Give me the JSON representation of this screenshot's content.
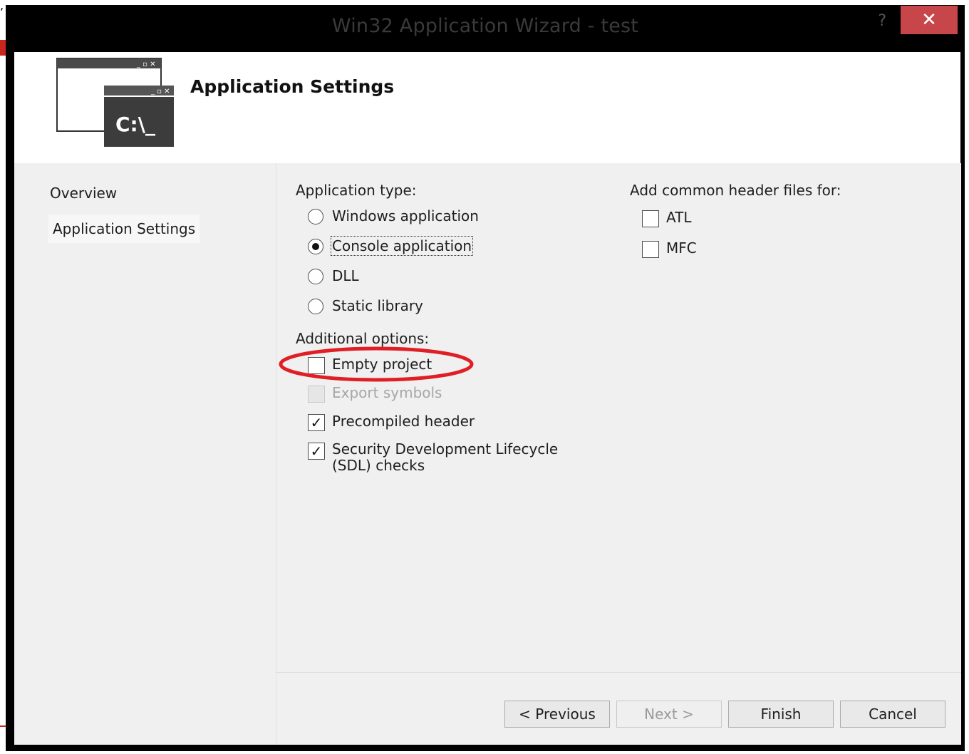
{
  "window": {
    "title": "Win32 Application Wizard - test",
    "help_label": "?",
    "close_label": "✕"
  },
  "header": {
    "title": "Application Settings",
    "icon_prompt": "C:\\_"
  },
  "sidebar": {
    "items": [
      {
        "label": "Overview"
      },
      {
        "label": "Application Settings",
        "selected": true
      }
    ]
  },
  "application_type": {
    "label": "Application type:",
    "options": [
      {
        "label": "Windows application",
        "checked": false
      },
      {
        "label": "Console application",
        "checked": true
      },
      {
        "label": "DLL",
        "checked": false
      },
      {
        "label": "Static library",
        "checked": false
      }
    ]
  },
  "additional_options": {
    "label": "Additional options:",
    "options": [
      {
        "label": "Empty project",
        "checked": false,
        "enabled": true
      },
      {
        "label": "Export symbols",
        "checked": false,
        "enabled": false
      },
      {
        "label": "Precompiled header",
        "checked": true,
        "enabled": true
      },
      {
        "label": "Security Development Lifecycle (SDL) checks",
        "checked": true,
        "enabled": true
      }
    ]
  },
  "common_headers": {
    "label": "Add common header files for:",
    "options": [
      {
        "label": "ATL",
        "checked": false
      },
      {
        "label": "MFC",
        "checked": false
      }
    ]
  },
  "buttons": {
    "previous": "< Previous",
    "next": "Next >",
    "finish": "Finish",
    "cancel": "Cancel"
  },
  "colors": {
    "title_bar": "#000000",
    "close_button": "#c7464a",
    "dialog_bg": "#f0f0f0",
    "highlight_annotation": "#e01e25"
  },
  "check_mark": "✓"
}
